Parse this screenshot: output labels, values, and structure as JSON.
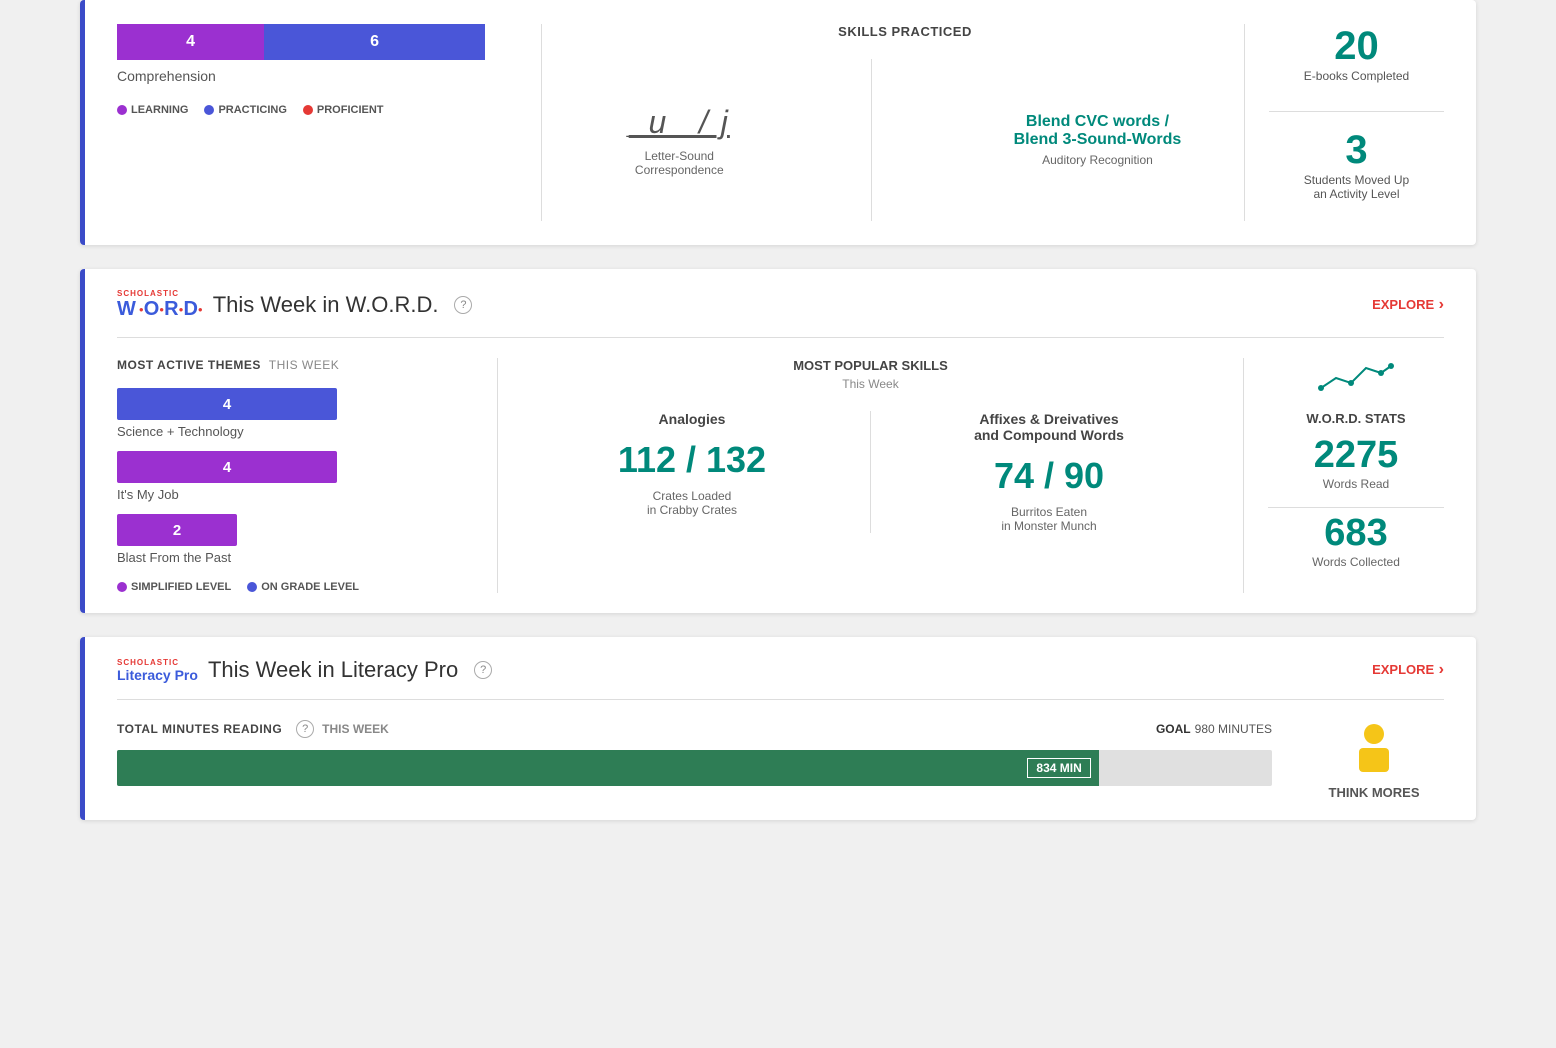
{
  "topCard": {
    "barPurple": "4",
    "barBlue": "6",
    "comprehensionLabel": "Comprehension",
    "legend": {
      "learning": "LEARNING",
      "practicing": "PRACTICING",
      "proficient": "PROFICIENT"
    },
    "skillsTitle": "SKILLS PRACTICED",
    "skill1": {
      "text": "_u_ / j",
      "label": "Letter-Sound\nCorrespondence"
    },
    "skill2": {
      "title": "Blend CVC words /\nBlend 3-Sound-Words",
      "label": "Auditory Recognition"
    },
    "stats": {
      "ebooks": "20",
      "ebooksLabel": "E-books Completed",
      "students": "3",
      "studentsLabel": "Students Moved Up\nan Activity Level"
    }
  },
  "wordCard": {
    "scholasticLabel": "SCHOLASTIC",
    "logoText": "W·O·R·D·",
    "title": "This Week in W.O.R.D.",
    "exploreLabel": "EXPLORE",
    "mostActiveTitle": "MOST ACTIVE THEMES",
    "thisWeek": "THIS WEEK",
    "themes": [
      {
        "value": "4",
        "label": "Science + Technology",
        "color": "blue"
      },
      {
        "value": "4",
        "label": "It's My Job",
        "color": "purple"
      },
      {
        "value": "2",
        "label": "Blast From the Past",
        "color": "purple-sm"
      }
    ],
    "legendSimplified": "SIMPLIFIED LEVEL",
    "legendOnGrade": "ON GRADE LEVEL",
    "mostPopularTitle": "MOST POPULAR SKILLS",
    "mostPopularSubtitle": "This Week",
    "skill1Name": "Analogies",
    "skill1Fraction": "112 / 132",
    "skill1Sub1": "Crates Loaded",
    "skill1Sub2": "in Crabby Crates",
    "skill2Name": "Affixes & Dreivatives\nand Compound Words",
    "skill2Fraction": "74 / 90",
    "skill2Sub1": "Burritos Eaten",
    "skill2Sub2": "in Monster Munch",
    "wordStatsTitle": "W.O.R.D. STATS",
    "wordsRead": "2275",
    "wordsReadLabel": "Words Read",
    "wordsCollected": "683",
    "wordsCollectedLabel": "Words Collected"
  },
  "literacyCard": {
    "scholasticLabel": "SCHOLASTIC",
    "logoText": "Literacy Pro",
    "title": "This Week in Literacy Pro",
    "exploreLabel": "EXPLORE",
    "totalMinutesLabel": "TOTAL MINUTES READING",
    "thisWeek": "THIS WEEK",
    "goalLabel": "GOAL",
    "goalValue": "980 MINUTES",
    "progressValue": "85",
    "progressLabel": "834 MIN",
    "thinkMoresLabel": "THINK MORES"
  }
}
